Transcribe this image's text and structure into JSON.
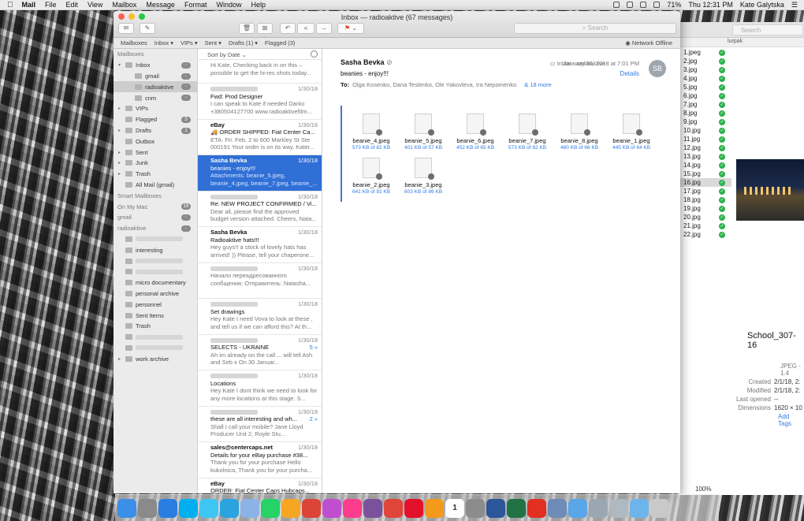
{
  "menubar": {
    "app": "Mail",
    "items": [
      "File",
      "Edit",
      "View",
      "Mailbox",
      "Message",
      "Format",
      "Window",
      "Help"
    ],
    "battery": "71%",
    "clock": "Thu 12:31 PM",
    "user": "Kate Galytska"
  },
  "window": {
    "title": "Inbox — radioaktive (67 messages)",
    "search_placeholder": "Search",
    "network": "Network Offline"
  },
  "favorites": [
    "Mailboxes",
    "Inbox ▾",
    "VIPs ▾",
    "Sent ▾",
    "Drafts (1) ▾",
    "Flagged (3)"
  ],
  "sidebar": {
    "rows": [
      {
        "t": "sec",
        "label": "Mailboxes"
      },
      {
        "t": "item",
        "label": "Inbox",
        "lvl": 0,
        "tri": "▾",
        "badge": "◦"
      },
      {
        "t": "item",
        "label": "gmail",
        "lvl": 1,
        "badge": "◦"
      },
      {
        "t": "item",
        "label": "radioaktive",
        "lvl": 1,
        "badge": "◦",
        "sel": true
      },
      {
        "t": "item",
        "label": "cnm",
        "lvl": 1,
        "badge": "◦"
      },
      {
        "t": "item",
        "label": "VIPs",
        "lvl": 0,
        "tri": "▸"
      },
      {
        "t": "item",
        "label": "Flagged",
        "lvl": 0,
        "badge": "3"
      },
      {
        "t": "item",
        "label": "Drafts",
        "lvl": 0,
        "tri": "▸",
        "badge": "1"
      },
      {
        "t": "item",
        "label": "Outbox",
        "lvl": 0
      },
      {
        "t": "item",
        "label": "Sent",
        "lvl": 0,
        "tri": "▸"
      },
      {
        "t": "item",
        "label": "Junk",
        "lvl": 0,
        "tri": "▸"
      },
      {
        "t": "item",
        "label": "Trash",
        "lvl": 0,
        "tri": "▸"
      },
      {
        "t": "item",
        "label": "All Mail (gmail)",
        "lvl": 0
      },
      {
        "t": "sec",
        "label": "Smart Mailboxes"
      },
      {
        "t": "sec",
        "label": "On My Mac",
        "badge": "19"
      },
      {
        "t": "sec",
        "label": "gmail",
        "badge": "◦"
      },
      {
        "t": "sec",
        "label": "radioaktive",
        "badge": "◦"
      },
      {
        "t": "item",
        "label": "",
        "lvl": 0,
        "blur": true
      },
      {
        "t": "item",
        "label": "interesting",
        "lvl": 0
      },
      {
        "t": "item",
        "label": "",
        "lvl": 0,
        "blur": true
      },
      {
        "t": "item",
        "label": "",
        "lvl": 0,
        "blur": true
      },
      {
        "t": "item",
        "label": "micro documentary",
        "lvl": 0
      },
      {
        "t": "item",
        "label": "personal archive",
        "lvl": 0
      },
      {
        "t": "item",
        "label": "personnel",
        "lvl": 0
      },
      {
        "t": "item",
        "label": "Sent Items",
        "lvl": 0
      },
      {
        "t": "item",
        "label": "Trash",
        "lvl": 0
      },
      {
        "t": "item",
        "label": "",
        "lvl": 0,
        "blur": true
      },
      {
        "t": "item",
        "label": "",
        "lvl": 0,
        "blur": true
      },
      {
        "t": "item",
        "label": "work archive",
        "lvl": 0,
        "tri": "▸"
      }
    ]
  },
  "list": {
    "sort": "Sort by Date ⌄",
    "messages": [
      {
        "from": "",
        "date": "",
        "subj": "",
        "prev": "Hi Kate, Checking back in on this – possible to get the hi-res shots today..."
      },
      {
        "from": "",
        "date": "1/30/18",
        "subj": "Fwd: Prod Designer",
        "prev": "I can speak to Kate if needed Darko +380504127700 www.radioaktivefilm..."
      },
      {
        "from": "eBay",
        "date": "1/30/18",
        "subj": "🚚 ORDER SHIPPED: Fiat Center Ca...",
        "prev": "ETA: Fri. Feb. 2 to 600 Markley St Ste 000191 Your order is on its way, Kater..."
      },
      {
        "from": "Sasha Bevka",
        "date": "1/30/18",
        "subj": "beanies - enjoy!!!",
        "prev": "Attachments: beanie_5.jpeg, beanie_4.jpeg, beanie_7.jpeg, beanie_...",
        "sel": true
      },
      {
        "from": "",
        "date": "1/30/18",
        "subj": "Re: NEW PROJECT CONFIRMED / Vi...",
        "prev": "Dear all, please find the approved budget version attached. Cheers, Nata..."
      },
      {
        "from": "Sasha Bevka",
        "date": "1/30/18",
        "subj": "Radioaktive hats!!!",
        "prev": "Hey guys!! a stock of lovely hats has arrived! )) Please, tell your chaperone..."
      },
      {
        "from": "",
        "date": "1/30/18",
        "subj": "",
        "prev": "Начало переадресованного сообщения: Отправитель: Natasha..."
      },
      {
        "from": "",
        "date": "1/30/18",
        "subj": "Set drawings",
        "prev": "Hey Kate I need Vova to look at these , and tell us if we can afford this? At th..."
      },
      {
        "from": "",
        "date": "1/30/18",
        "subj": "SELECTS - UKRAINE",
        "prev": "Ah im already on the call ... will tell Ash and Seb x On 30 Januar...",
        "count": "5 »"
      },
      {
        "from": "",
        "date": "1/30/18",
        "subj": "Locations",
        "prev": "Hey Kate I dont think we need to look for any more locations at this stage. S..."
      },
      {
        "from": "",
        "date": "1/30/18",
        "subj": "these are all interesting and wh...",
        "prev": "Shall I call your mobile? Jane Lloyd Producer Unit 2, Royle Stu...",
        "count": "2 »"
      },
      {
        "from": "sales@centercaps.net",
        "date": "1/30/18",
        "subj": "Details for your eBay purchase #38...",
        "prev": "Thank you for your purchase Hello kukolnica, Thank you for your purcha..."
      },
      {
        "from": "eBay",
        "date": "1/30/18",
        "subj": "ORDER: Fiat Center Caps Hubcaps...",
        "prev": "Thank you for your order! We will..."
      }
    ]
  },
  "reader": {
    "from": "Sasha Bevka",
    "subject": "beanies - enjoy!!!",
    "mailbox": "Inbox - radioaktive",
    "date": "January 30, 2018 at 7:01 PM",
    "details": "Details",
    "avatar": "SB",
    "to_label": "To:",
    "to": "Olga Kosenko,   Dana Teslenko,   Ole Yakovleva,   Ira Nepomenko",
    "more": "& 18 more",
    "attachments": [
      {
        "name": "beanie_4.jpeg",
        "size": "573 KB of 82 KB"
      },
      {
        "name": "beanie_5.jpeg",
        "size": "401 KB of 57 KB"
      },
      {
        "name": "beanie_6.jpeg",
        "size": "452 KB of 65 KB"
      },
      {
        "name": "beanie_7.jpeg",
        "size": "573 KB of 82 KB"
      },
      {
        "name": "beanie_8.jpeg",
        "size": "460 KB of 66 KB"
      },
      {
        "name": "beanie_1.jpeg",
        "size": "445 KB of 64 KB"
      },
      {
        "name": "beanie_2.jpeg",
        "size": "641 KB of 92 KB"
      },
      {
        "name": "beanie_3.jpeg",
        "size": "603 KB of 86 KB"
      }
    ]
  },
  "preview": {
    "search": "Search",
    "col": "lurpak",
    "files": [
      "1.jpeg",
      "2.jpg",
      "3.jpg",
      "4.jpg",
      "5.jpg",
      "6.jpg",
      "7.jpg",
      "8.jpg",
      "9.jpg",
      "10.jpg",
      "11.jpg",
      "12.jpg",
      "13.jpg",
      "14.jpg",
      "15.jpg",
      "16.jpg",
      "17.jpg",
      "18.jpg",
      "19.jpg",
      "20.jpg",
      "21.jpg",
      "22.jpg"
    ],
    "title": "School_307-16",
    "kind": "JPEG - 1.4",
    "created_k": "Created",
    "created": "2/1/18, 2:",
    "modified_k": "Modified",
    "modified": "2/1/18, 2:",
    "opened_k": "Last opened",
    "opened": "--",
    "dims_k": "Dimensions",
    "dims": "1620 × 10",
    "tags": "Add Tags",
    "zoom": "100%"
  },
  "dock": [
    "finder",
    "launchpad",
    "safari",
    "skype",
    "messages",
    "telegram",
    "preview",
    "whatsapp",
    "photos",
    "chrome",
    "pinwheel",
    "itunes",
    "viber",
    "bookmark",
    "opera",
    "books",
    "calendar",
    "settings",
    "word",
    "excel",
    "acrobat",
    "photos2",
    "folder",
    "screen",
    "screen2",
    "folder2",
    "trash"
  ]
}
